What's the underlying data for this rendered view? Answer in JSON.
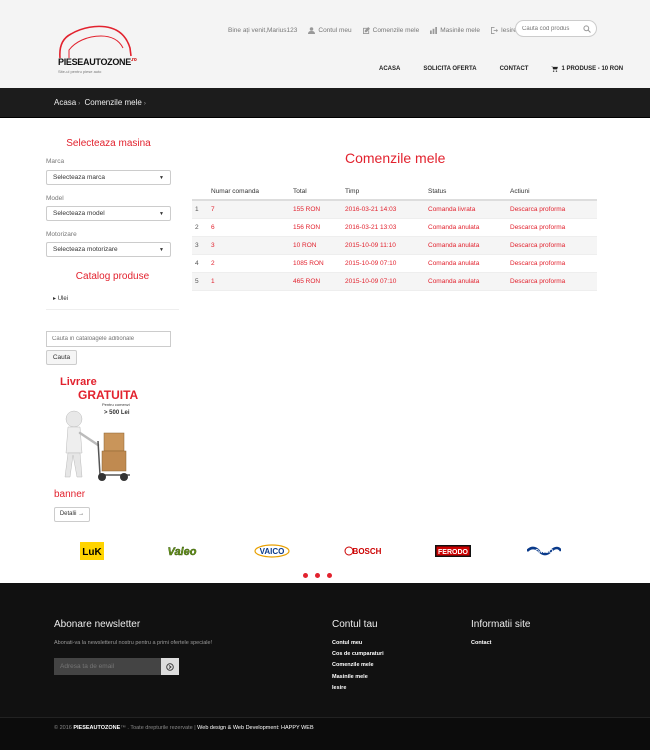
{
  "header": {
    "logo_text": "PIESEAUTOZONE",
    "logo_suffix": ".ro",
    "logo_tagline": "Site-ul pentru piese auto",
    "greeting": "Bine ați venit,Marius123",
    "links": [
      "Contul meu",
      "Comenzile mele",
      "Masinile mele",
      "Iesire"
    ],
    "search_placeholder": "Cauta cod produs",
    "nav": [
      "ACASA",
      "SOLICITA OFERTA",
      "CONTACT"
    ],
    "cart": "1 PRODUSE - 10 RON"
  },
  "breadcrumb": {
    "home": "Acasa",
    "current": "Comenzile mele"
  },
  "sidebar": {
    "car_title": "Selecteaza masina",
    "fields": [
      {
        "label": "Marca",
        "value": "Selecteaza marca"
      },
      {
        "label": "Model",
        "value": "Selecteaza model"
      },
      {
        "label": "Motorizare",
        "value": "Selecteaza motorizare"
      }
    ],
    "catalog_title": "Catalog produse",
    "catalog_item": "Ulei",
    "catalog_search_placeholder": "Cauta in cataloagele aditionale",
    "search_button": "Cauta",
    "promo_line1": "Livrare",
    "promo_line2": "GRATUITA",
    "promo_line3": "Pentru comenzi",
    "promo_line4": "> 500 Lei",
    "banner_title": "banner",
    "details_button": "Detalii →"
  },
  "orders": {
    "title": "Comenzile mele",
    "columns": [
      "",
      "Numar comanda",
      "Total",
      "Timp",
      "Status",
      "Actiuni"
    ],
    "rows": [
      {
        "idx": "1",
        "number": "7",
        "total": "155 RON",
        "time": "2016-03-21 14:03",
        "status": "Comanda livrata",
        "action": "Descarca proforma"
      },
      {
        "idx": "2",
        "number": "6",
        "total": "156 RON",
        "time": "2016-03-21 13:03",
        "status": "Comanda anulata",
        "action": "Descarca proforma"
      },
      {
        "idx": "3",
        "number": "3",
        "total": "10 RON",
        "time": "2015-10-09 11:10",
        "status": "Comanda anulata",
        "action": "Descarca proforma"
      },
      {
        "idx": "4",
        "number": "2",
        "total": "1085 RON",
        "time": "2015-10-09 07:10",
        "status": "Comanda anulata",
        "action": "Descarca proforma"
      },
      {
        "idx": "5",
        "number": "1",
        "total": "465 RON",
        "time": "2015-10-09 07:10",
        "status": "Comanda anulata",
        "action": "Descarca proforma"
      }
    ]
  },
  "brands": [
    "LuK",
    "Valeo",
    "VAICO",
    "BOSCH",
    "FERODO",
    "DAYCO"
  ],
  "footer": {
    "newsletter_title": "Abonare newsletter",
    "newsletter_text": "Abonati-va la newsletterul nostru pentru a primi ofertele speciale!",
    "newsletter_placeholder": "Adresa ta de email",
    "account_title": "Contul tau",
    "account_links": [
      "Contul meu",
      "Cos de cumparaturi",
      "Comenzile mele",
      "Masinile mele",
      "Iesire"
    ],
    "info_title": "Informatii site",
    "info_links": [
      "Contact"
    ],
    "copyright_year": "© 2016",
    "copyright_brand": "PIESEAUTOZONE",
    "copyright_rest": "™ . Toate drepturile rezervate |",
    "credits": "Web design & Web Development: HAPPY WEB"
  },
  "colors": {
    "accent": "#e2222e",
    "dark": "#111111"
  }
}
